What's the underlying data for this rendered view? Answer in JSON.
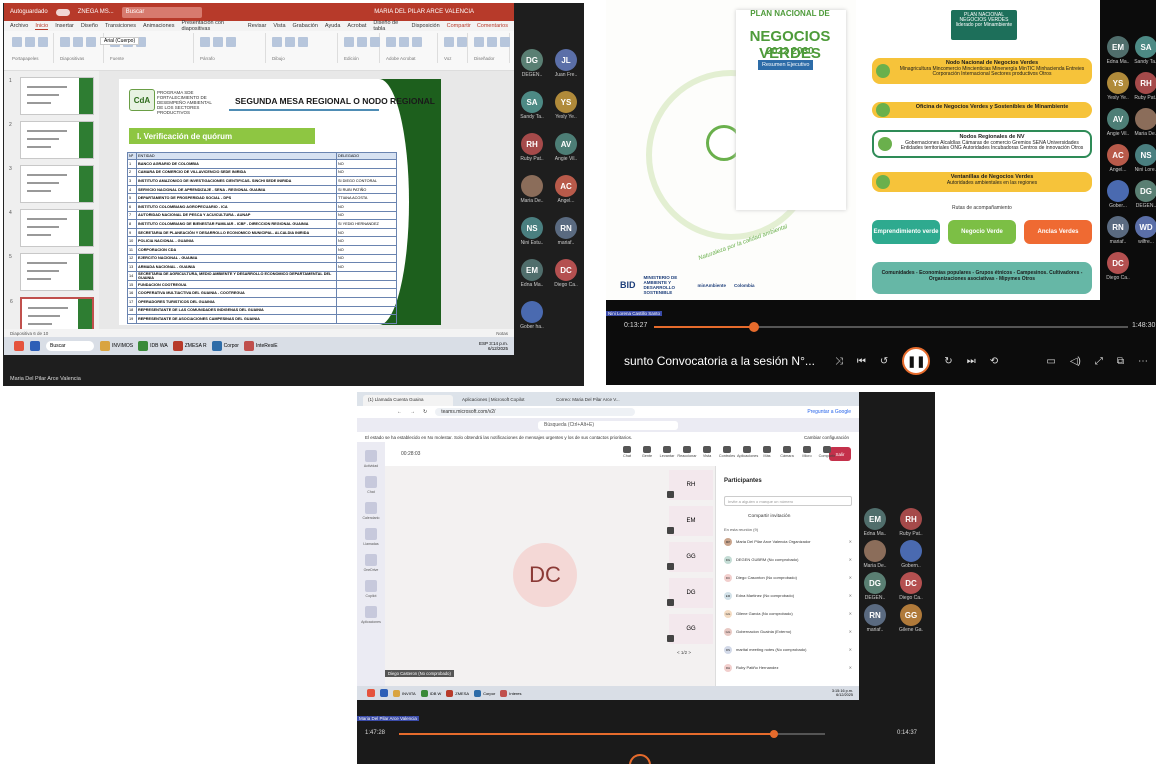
{
  "shot1": {
    "window": {
      "autosave": "Autoguardado",
      "filename": "ZNEGA MS...",
      "search": "Buscar",
      "user": "MARIA DEL PILAR ARCE VALENCIA"
    },
    "menu": [
      "Archivo",
      "Inicio",
      "Insertar",
      "Diseño",
      "Transiciones",
      "Animaciones",
      "Presentación con diapositivas",
      "Revisar",
      "Vista",
      "Grabación",
      "Ayuda",
      "Acrobat",
      "Diseño de tabla",
      "Disposición"
    ],
    "menu_right": [
      "Compartir",
      "Comentarios"
    ],
    "ribbon_groups": [
      "Portapapeles",
      "Diapositivas",
      "Fuente",
      "Párrafo",
      "Dibujo",
      "Edición",
      "Adobe Acrobat",
      "Voz",
      "Diseñador"
    ],
    "ribbon_font": "Arial (Cuerpo)",
    "thumb_numbers": [
      "1",
      "2",
      "3",
      "4",
      "5",
      "6"
    ],
    "slide": {
      "logo": "CdA",
      "program": "PROGRAMA SDE FORTALECIMIENTO DE DESEMPEÑO AMBIENTAL DE LOS SECTORES PRODUCTIVOS",
      "title": "SEGUNDA MESA REGIONAL O NODO REGIONAL",
      "section": "I. Verificación de quórum",
      "table_headers": [
        "Nº",
        "ENTIDAD",
        "DELEGADO"
      ],
      "rows": [
        [
          "1",
          "BANCO AGRARIO DE COLOMBIA",
          "NO"
        ],
        [
          "2",
          "CAMARA DE COMERCIO DE VILLAVICENCIO SEDE INIRIDA",
          "NO"
        ],
        [
          "3",
          "INSTITUTO AMAZONICO DE INVESTIGACIONES CIENTIFICAS- SINCHI SEDE INIRIDA",
          "SI DIEGO CONTORAL"
        ],
        [
          "4",
          "SERVICIO NACIONAL DE APRENDIZAJE - SENA - REGIONAL GUAINIA",
          "SI RUBI PATIÑO"
        ],
        [
          "5",
          "DEPARTAMENTO DE PROSPERIDAD SOCIAL - DPS",
          "TTIANA ACOSTA"
        ],
        [
          "6",
          "INSTITUTO COLOMBIANO AGROPECUARIO - ICA",
          "NO"
        ],
        [
          "7",
          "AUTORIDAD NACIONAL DE PESCA Y ACUICULTURA - AUNAP",
          "NO"
        ],
        [
          "8",
          "INSTITUTO COLOMBIANO DE BIENESTAR FAMILIAR - ICBF - DIRECCION REGIONAL GUAINIA",
          "SI YEDID HERNANDEZ"
        ],
        [
          "9",
          "SECRETARIA DE PLANEACIÓN Y DESARROLLO ECONOMICO MUNICIPAL- ALCALDIA INIRIDA",
          "NO"
        ],
        [
          "10",
          "POLICIA NACIONAL - GUAINIA",
          "NO"
        ],
        [
          "11",
          "CORPORACION CDA",
          "NO"
        ],
        [
          "12",
          "EJERCITO NACIONAL - GUAINIA",
          "NO"
        ],
        [
          "13",
          "ARMADA NACIONAL - GUAINIA",
          "NO"
        ],
        [
          "14",
          "SECRETARIA DE AGRICULTURA, MEDIO AMBIENTE Y DESARROLLO ECONOMICO DEPARTAMENTAL DEL GUAINIA",
          ""
        ],
        [
          "15",
          "FUNDACION COOTREGUA",
          ""
        ],
        [
          "16",
          "COOPERATIVA MULTIACTIVA DEL GUAINIA - COOTREGUA",
          ""
        ],
        [
          "17",
          "OPERADORES TURISTICOS DEL GUAINIA",
          ""
        ],
        [
          "18",
          "REPRESENTANTE DE LAS COMUNIDADES INDIGENAS DEL GUAINIA",
          ""
        ],
        [
          "19",
          "REPRESENTANTE DE ASOCIACIONES CAMPESINAS DEL GUAINIA",
          ""
        ]
      ]
    },
    "status_left": "Diapositiva 6 de 10",
    "status_right": "Notas",
    "taskbar": {
      "search": "Buscar",
      "apps": [
        "INVIMOS",
        "IDB WA",
        "ZMESA R",
        "Corpor",
        "InteResiE"
      ],
      "lang": "ESP",
      "clock_time": "3:14 p.m.",
      "clock_date": "6/12/2025"
    },
    "name_label": "Maria Del Pilar Arce Valencia",
    "gallery": [
      {
        "initials": "DG",
        "name": "DEGEN..",
        "color": "#5a7f73"
      },
      {
        "initials": "JL",
        "name": "Juan Fre..",
        "color": "#5b6fa8"
      },
      {
        "initials": "SA",
        "name": "Sandy Ta..",
        "color": "#4d8a85"
      },
      {
        "initials": "YS",
        "name": "Yesly Ye..",
        "color": "#b08a3a"
      },
      {
        "initials": "RH",
        "name": "Ruby Pat..",
        "color": "#a54a4a"
      },
      {
        "initials": "AV",
        "name": "Angie Vil..",
        "color": "#4d7e76"
      },
      {
        "initials": "",
        "name": "Maria De..",
        "color": "#8b6d5a"
      },
      {
        "initials": "AC",
        "name": "Angel...",
        "color": "#b85a4a"
      },
      {
        "initials": "NS",
        "name": "Nini Estu..",
        "color": "#4a7f80"
      },
      {
        "initials": "RN",
        "name": "mariaf..",
        "color": "#5a6a80"
      },
      {
        "initials": "EM",
        "name": "Edna Ma..",
        "color": "#506e6c"
      },
      {
        "initials": "DC",
        "name": "Diego Ca..",
        "color": "#b45050"
      },
      {
        "initials": "",
        "name": "Gober ha..",
        "color": "#4a6ab0"
      }
    ]
  },
  "shot2": {
    "doc": {
      "l1": "PLAN NACIONAL DE",
      "l2": "NEGOCIOS VERDES",
      "l3": "2022 2030",
      "l4": "Resumen Ejecutivo",
      "caption": "Naturaleza por la calidad ambiental",
      "logos": [
        "BID",
        "MINISTERIO DE AMBIENTE Y DESARROLLO SOSTENIBLE",
        "minAmbiente",
        "Colombia"
      ]
    },
    "right": {
      "header": "PLAN NACIONAL NEGOCIOS VERDES liderado por Minambiente",
      "boxes": [
        {
          "title": "Nodo Nacional de Negocios Verdes",
          "text": "Minagricultura Mincomercio Mincienticias Minenergía MinTIC Minhacienda Entreies Corporación Internacional Sectores productivos Otros",
          "color": "#f6c33a"
        },
        {
          "title": "Oficina de Negocios Verdes y Sostenibles de Minambiente",
          "text": "",
          "color": "#f6c33a"
        },
        {
          "title": "Nodos Regionales de NV",
          "text": "Gobernaciones Alcaldías Cámaras de comercio Gremios SENA Universidades Entidades territoriales ONG Autoridades Incubadoras Centros de innovación Otros",
          "color": "#f6c33a"
        },
        {
          "title": "Ventanillas de Negocios Verdes",
          "text": "Autoridades ambientales en las regiones",
          "color": "#f6c33a"
        }
      ],
      "rutas": "Rutas de acompañamiento",
      "pills": [
        "Emprendimiento verde",
        "Negocio Verde",
        "Anclas Verdes"
      ],
      "pill_colors": [
        "#2eaa8f",
        "#7cbf45",
        "#ef6a32"
      ],
      "bottom": "Comunidades - Economías populares - Grupos étnicos - Campesinos. Cultivadores - Organizaciones asociativas - Mipymes Otros"
    },
    "speaker": "Nini Lorena Castillo Santo",
    "time_current": "0:13:27",
    "time_total": "1:48:30",
    "progress": 0.21,
    "title": "sunto Convocatoria a la sesión N°...",
    "gallery": [
      {
        "initials": "EM",
        "name": "Edna Ma..",
        "color": "#506e6c"
      },
      {
        "initials": "SA",
        "name": "Sandy Ta..",
        "color": "#4d8a85"
      },
      {
        "initials": "YS",
        "name": "Yesly Ye..",
        "color": "#b08a3a"
      },
      {
        "initials": "RH",
        "name": "Ruby Pat..",
        "color": "#a54a4a"
      },
      {
        "initials": "AV",
        "name": "Angie Vil..",
        "color": "#4d7e76"
      },
      {
        "initials": "",
        "name": "Maria De..",
        "color": "#8b6d5a"
      },
      {
        "initials": "AC",
        "name": "Angel...",
        "color": "#b85a4a"
      },
      {
        "initials": "NS",
        "name": "Nini Lore..",
        "color": "#4a7f80"
      },
      {
        "initials": "",
        "name": "Gober...",
        "color": "#4a6ab0"
      },
      {
        "initials": "DG",
        "name": "DEGEN..",
        "color": "#5a7f73"
      },
      {
        "initials": "RN",
        "name": "mariaf..",
        "color": "#5a6a80"
      },
      {
        "initials": "WD",
        "name": "wilfre...",
        "color": "#5b6fa8"
      },
      {
        "initials": "DC",
        "name": "Diego Ca..",
        "color": "#b45050"
      }
    ]
  },
  "shot3": {
    "tabs": [
      "(1) Llamada Cuenta Guaina",
      "Aplicaciones | Microsoft Copilot",
      "Correo: Maria Del Pilar Arce V..."
    ],
    "url": "teams.microsoft.com/v2/",
    "ask_google": "Preguntar a Google",
    "search": "Búsqueda (Ctrl+Alt+E)",
    "notice": "El estado se ha establecido en No molestar. Solo obtendrá las notificaciones de mensajes urgentes y los de sus contactos prioritarios.",
    "notice_right": "Cambiar configuración",
    "rail": [
      "Actividad",
      "Chat",
      "Calendario",
      "Llamadas",
      "OneDrive",
      "Copilot",
      "Aplicaciones"
    ],
    "timer": "00:28:03",
    "controls": [
      "Chat",
      "Gente",
      "Levantar",
      "Reaccionar",
      "Vista",
      "Controles",
      "Aplicaciones",
      "Más",
      "Cámara",
      "Micro",
      "Compartir"
    ],
    "leave": "Salir",
    "big_avatar": "DC",
    "caption": "Diego Casteron (No comprobado)",
    "mini": [
      "RH",
      "EM",
      "GG",
      "DG",
      "GG"
    ],
    "pager": "< 1/2 >",
    "panel_title": "Participantes",
    "panel_search": "Invite a alguien o marque un número",
    "panel_invite": "Compartir invitación",
    "panel_section": "En esta reunión (9)",
    "participants": [
      {
        "initials": "MP",
        "name": "Maria Del Pilar Arce Valencia Organizador",
        "color": "#c9a48c"
      },
      {
        "initials": "DG",
        "name": "DEGEN GUBRM (No comprobado)",
        "color": "#c4dcd5"
      },
      {
        "initials": "DC",
        "name": "Diego Casonton (No comprobado)",
        "color": "#f2cfcd"
      },
      {
        "initials": "EM",
        "name": "Edna Martinez (No comprobado)",
        "color": "#d2e1e8"
      },
      {
        "initials": "GG",
        "name": "Gilene Garcia (No comprobado)",
        "color": "#f4dcc3"
      },
      {
        "initials": "GG",
        "name": "Gobernacion Guainia (Externo)",
        "color": "#e8c9c4"
      },
      {
        "initials": "RN",
        "name": "marital meeting notes (No comprobado)",
        "color": "#d2d9e8"
      },
      {
        "initials": "RH",
        "name": "Ruby Patiño Hernandez",
        "color": "#f2cfcd"
      }
    ],
    "taskbar_apps": [
      "INVIITA",
      "IDB W",
      "ZMESA",
      "Corpor",
      "Interes"
    ],
    "clock_time": "3:15:16 p.m.",
    "clock_date": "6/12/2025",
    "speaker": "Maria Del Pilar Arce Valencia",
    "time_current": "1:47:28",
    "time_remaining": "0:14:37",
    "progress": 0.88,
    "gallery": [
      {
        "initials": "EM",
        "name": "Edna Ma..",
        "color": "#506e6c"
      },
      {
        "initials": "RH",
        "name": "Ruby Pat..",
        "color": "#a54a4a"
      },
      {
        "initials": "",
        "name": "Maria De..",
        "color": "#8b6d5a"
      },
      {
        "initials": "",
        "name": "Gobern..",
        "color": "#4a6ab0"
      },
      {
        "initials": "DG",
        "name": "DEGEN..",
        "color": "#5a7f73"
      },
      {
        "initials": "DC",
        "name": "Diego Ca..",
        "color": "#b45050"
      },
      {
        "initials": "RN",
        "name": "mariaf..",
        "color": "#5a6a80"
      },
      {
        "initials": "GG",
        "name": "Gilene Ga..",
        "color": "#b07a3a"
      }
    ]
  }
}
